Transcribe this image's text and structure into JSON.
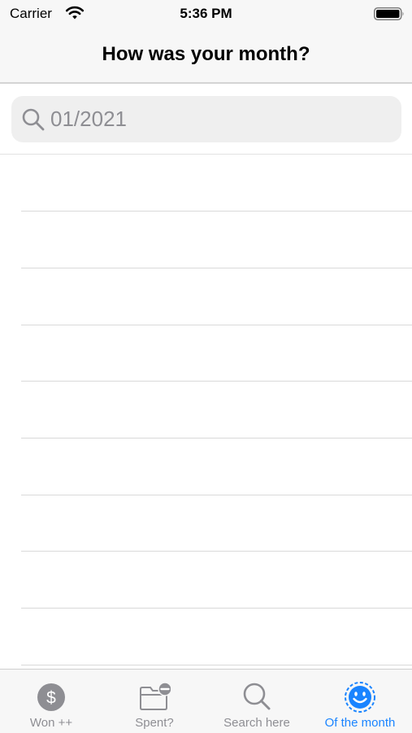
{
  "status_bar": {
    "carrier": "Carrier",
    "time": "5:36 PM",
    "wifi_icon": "wifi-icon",
    "battery_icon": "battery-icon"
  },
  "nav": {
    "title": "How was your month?"
  },
  "search": {
    "placeholder": "01/2021",
    "value": "",
    "icon": "magnifier-icon"
  },
  "table": {
    "rows": [
      "",
      "",
      "",
      "",
      "",
      "",
      "",
      "",
      ""
    ]
  },
  "tabs": [
    {
      "label": "Won ++",
      "icon": "dollar-circle-icon",
      "active": false
    },
    {
      "label": "Spent?",
      "icon": "folder-minus-icon",
      "active": false
    },
    {
      "label": "Search here",
      "icon": "search-icon",
      "active": false
    },
    {
      "label": "Of the month",
      "icon": "smiley-icon",
      "active": true
    }
  ],
  "colors": {
    "accent": "#1a84ff",
    "inactive_tab": "#8e8e93",
    "bar_background": "#f7f7f7",
    "separator": "#d9d9d9",
    "search_field": "#efefef"
  }
}
